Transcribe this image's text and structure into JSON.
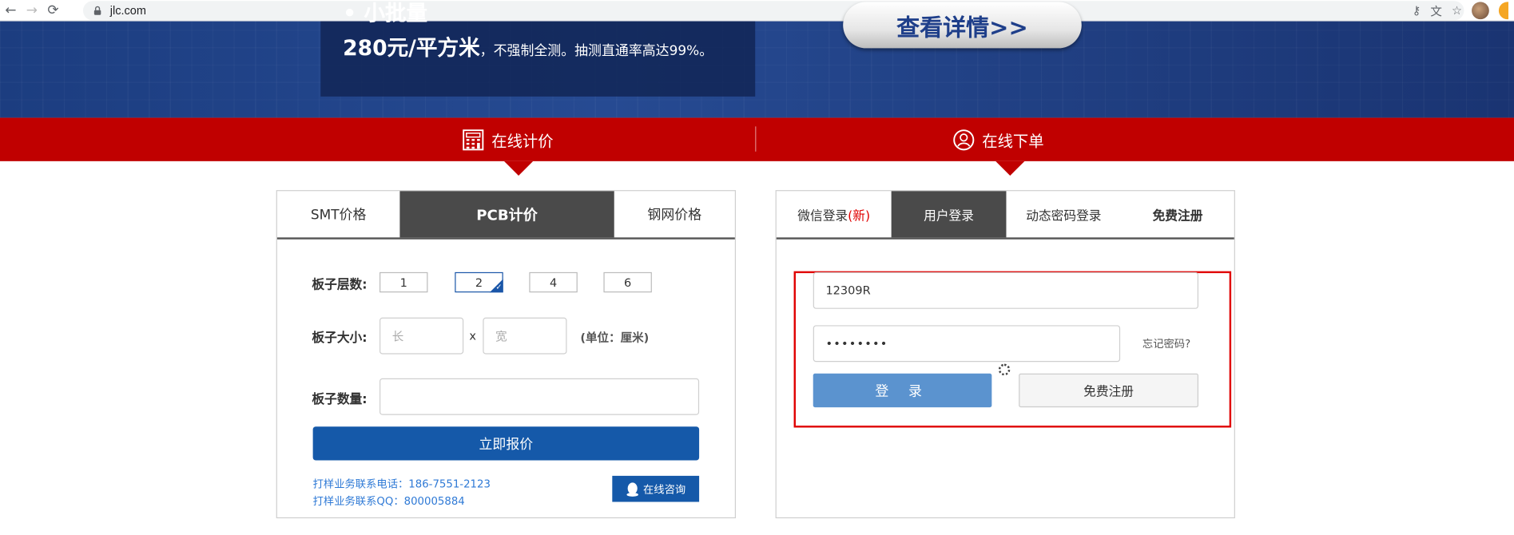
{
  "browser": {
    "url": "jlc.com"
  },
  "banner": {
    "heading": "• 小批量",
    "price": "280元/平方米",
    "price_note": "，不强制全测。抽测直通率高达99%。",
    "detail_button": "查看详情>>"
  },
  "nav": {
    "quote_tab": "在线计价",
    "order_tab": "在线下单"
  },
  "quote": {
    "tabs": [
      "SMT价格",
      "PCB计价",
      "钢网价格"
    ],
    "active_tab": "PCB计价",
    "layers_label": "板子层数:",
    "layer_options": [
      "1",
      "2",
      "4",
      "6"
    ],
    "selected_layer": "2",
    "size_label": "板子大小:",
    "length_placeholder": "长",
    "width_placeholder": "宽",
    "size_sep": "x",
    "size_unit": "(单位：厘米)",
    "qty_label": "板子数量:",
    "qty_value": "",
    "submit": "立即报价",
    "phone_line": "打样业务联系电话：186-7551-2123",
    "qq_line": "打样业务联系QQ：800005884",
    "consult_button": "在线咨询"
  },
  "login": {
    "tabs": [
      "微信登录",
      "用户登录",
      "动态密码登录",
      "免费注册"
    ],
    "wechat_new": "(新)",
    "active_tab": "用户登录",
    "username": "12309R",
    "password": "••••••••",
    "forgot": "忘记密码?",
    "login_button": "登 录",
    "register_button": "免费注册"
  },
  "colors": {
    "brand_red": "#c00000",
    "brand_blue": "#1559a9",
    "login_blue": "#5b93cf"
  }
}
